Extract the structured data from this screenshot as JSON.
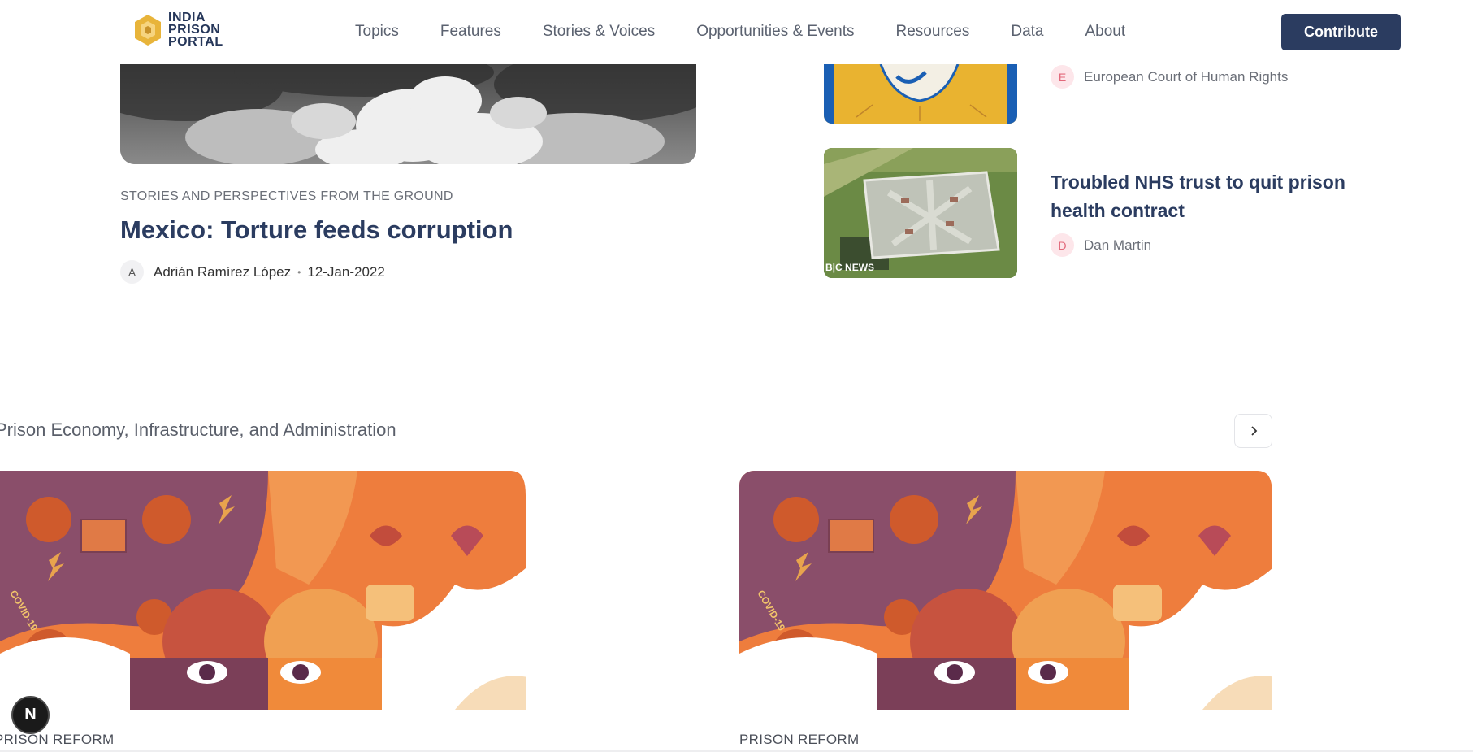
{
  "header": {
    "logo_lines": [
      "INDIA",
      "PRISON",
      "PORTAL"
    ],
    "nav": [
      "Topics",
      "Features",
      "Stories & Voices",
      "Opportunities & Events",
      "Resources",
      "Data",
      "About"
    ],
    "contribute_label": "Contribute"
  },
  "featured": {
    "category": "STORIES AND PERSPECTIVES FROM THE GROUND",
    "title": "Mexico: Torture feeds corruption",
    "author_initial": "A",
    "author": "Adrián Ramírez López",
    "date": "12-Jan-2022"
  },
  "right_list": [
    {
      "author_initial": "E",
      "author": "European Court of Human Rights"
    },
    {
      "title": "Troubled NHS trust to quit prison health contract",
      "author_initial": "D",
      "author": "Dan Martin",
      "image_caption": "B|C NEWS"
    }
  ],
  "section": {
    "title": "Prison Economy, Infrastructure, and Administration",
    "next_icon": "chevron-right-icon",
    "cards": [
      {
        "category": "PRISON REFORM"
      },
      {
        "category": "PRISON REFORM"
      }
    ]
  },
  "badge_letter": "N",
  "colors": {
    "brand": "#2b3c60",
    "accent_orange": "#ef7a3f",
    "avatar_pink": "#fde6ea"
  }
}
